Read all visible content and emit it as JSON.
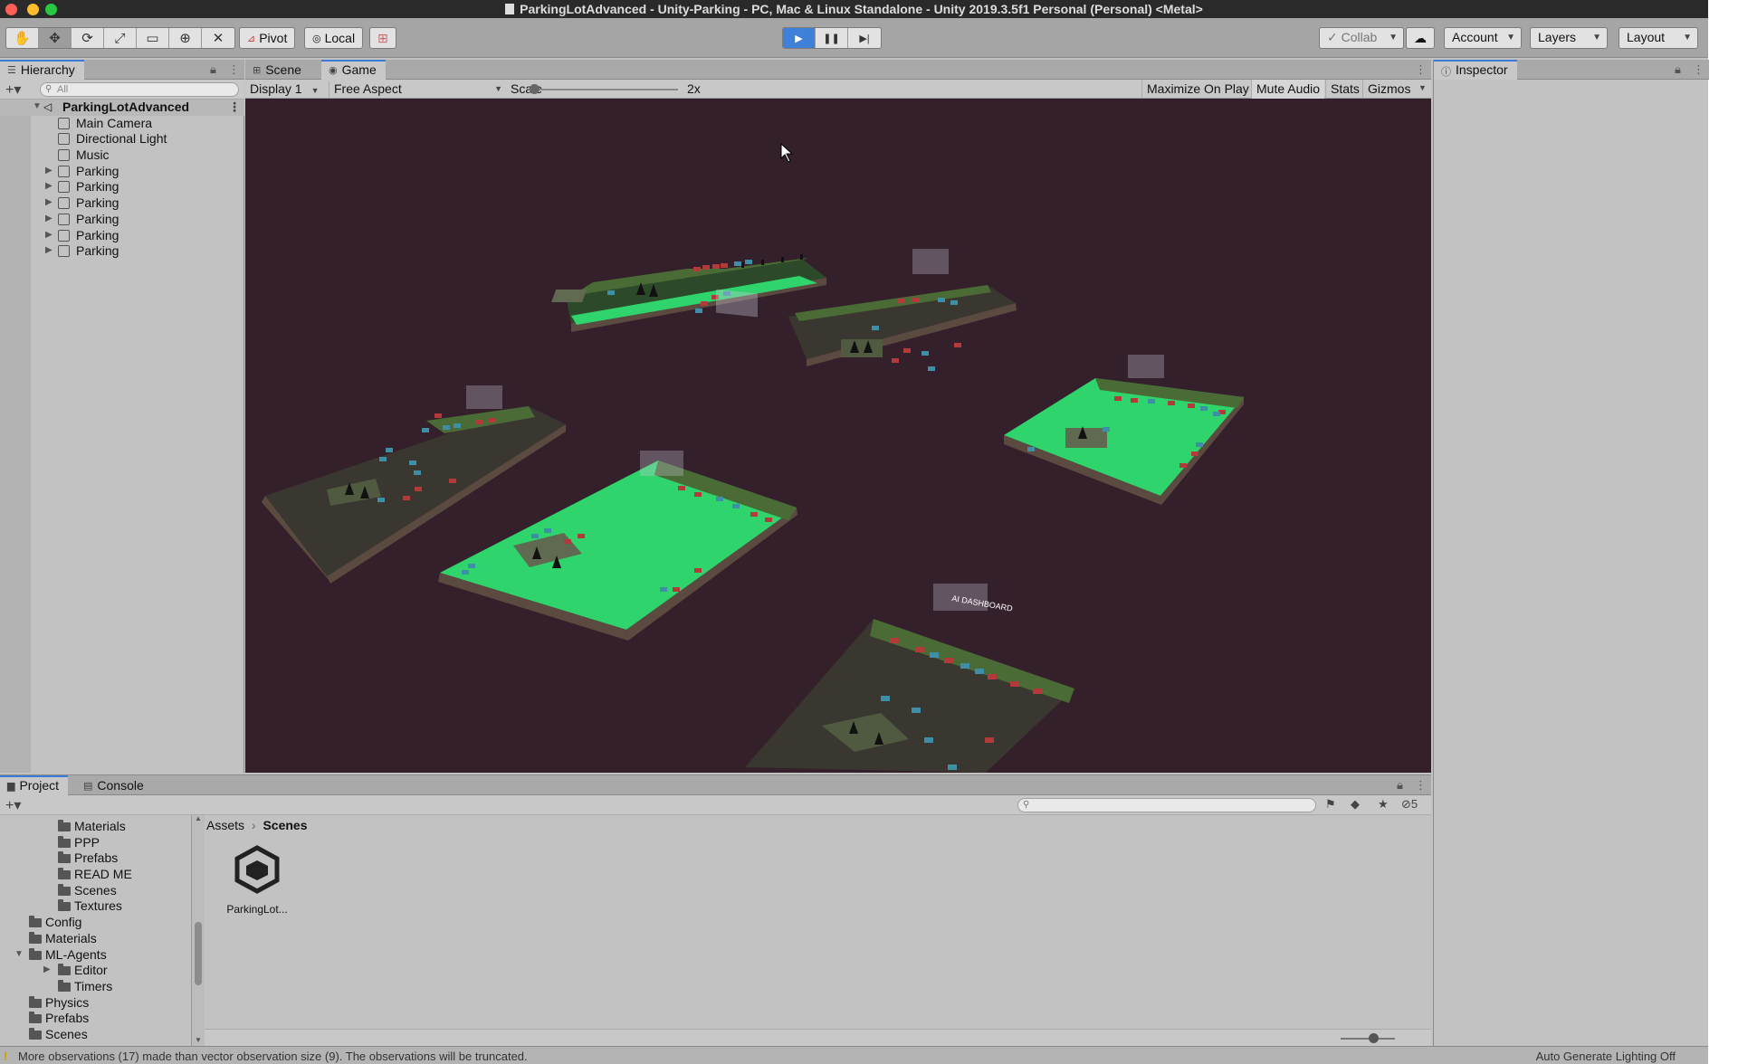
{
  "window": {
    "title": "ParkingLotAdvanced - Unity-Parking - PC, Mac & Linux Standalone - Unity 2019.3.5f1 Personal (Personal) <Metal>"
  },
  "toolbar": {
    "tools": [
      "hand-tool",
      "move-tool",
      "rotate-tool",
      "scale-tool",
      "rect-tool",
      "transform-tool",
      "custom-tool"
    ],
    "pivot_label": "Pivot",
    "local_label": "Local",
    "collab_label": "Collab",
    "account_label": "Account",
    "layers_label": "Layers",
    "layout_label": "Layout"
  },
  "hierarchy": {
    "tab_label": "Hierarchy",
    "search_placeholder": "All",
    "root": "ParkingLotAdvanced",
    "items": [
      {
        "label": "Main Camera",
        "expandable": false
      },
      {
        "label": "Directional Light",
        "expandable": false
      },
      {
        "label": "Music",
        "expandable": false
      },
      {
        "label": "Parking",
        "expandable": true
      },
      {
        "label": "Parking",
        "expandable": true
      },
      {
        "label": "Parking",
        "expandable": true
      },
      {
        "label": "Parking",
        "expandable": true
      },
      {
        "label": "Parking",
        "expandable": true
      },
      {
        "label": "Parking",
        "expandable": true
      }
    ]
  },
  "game": {
    "tabs": [
      "Scene",
      "Game"
    ],
    "active_tab": "Game",
    "display": "Display 1",
    "aspect": "Free Aspect",
    "scale_label": "Scale",
    "scale_value": "2x",
    "scale_fraction": 0.0,
    "toggles": [
      "Maximize On Play",
      "Mute Audio",
      "Stats",
      "Gizmos"
    ],
    "dashboard_label": "AI DASHBOARD",
    "colors": {
      "background": "#34202a",
      "green_lot": "#33cc66",
      "dark_lot": "#3a3630",
      "red_car": "#b33a3a",
      "blue_car": "#3f8ea8"
    }
  },
  "inspector": {
    "tab_label": "Inspector"
  },
  "project": {
    "tabs": [
      "Project",
      "Console"
    ],
    "tree": [
      {
        "label": "Materials",
        "indent": 2,
        "expandable": false
      },
      {
        "label": "PPP",
        "indent": 2,
        "expandable": false
      },
      {
        "label": "Prefabs",
        "indent": 2,
        "expandable": false
      },
      {
        "label": "READ ME",
        "indent": 2,
        "expandable": false
      },
      {
        "label": "Scenes",
        "indent": 2,
        "expandable": false
      },
      {
        "label": "Textures",
        "indent": 2,
        "expandable": false
      },
      {
        "label": "Config",
        "indent": 1,
        "expandable": false
      },
      {
        "label": "Materials",
        "indent": 1,
        "expandable": false
      },
      {
        "label": "ML-Agents",
        "indent": 1,
        "expandable": true,
        "expanded": true
      },
      {
        "label": "Editor",
        "indent": 2,
        "expandable": true
      },
      {
        "label": "Timers",
        "indent": 2,
        "expandable": false
      },
      {
        "label": "Physics",
        "indent": 1,
        "expandable": false
      },
      {
        "label": "Prefabs",
        "indent": 1,
        "expandable": false
      },
      {
        "label": "Scenes",
        "indent": 1,
        "expandable": false
      }
    ],
    "breadcrumb": [
      "Assets",
      "Scenes"
    ],
    "assets": [
      {
        "label": "ParkingLot..."
      }
    ],
    "hidden_count": "5"
  },
  "status": {
    "message": "More observations (17) made than vector observation size (9). The observations will be truncated.",
    "right_text": "Auto Generate Lighting Off"
  }
}
